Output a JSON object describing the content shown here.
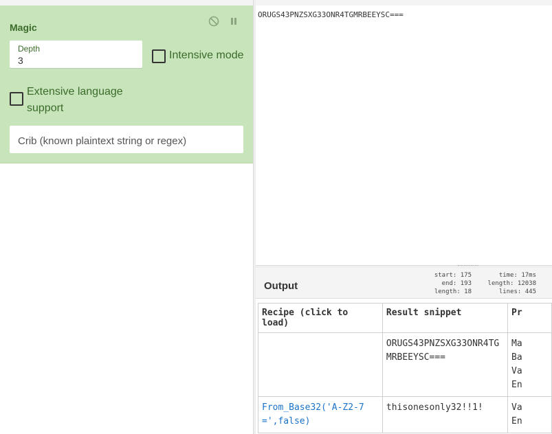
{
  "recipe": {
    "operation": {
      "title": "Magic",
      "depth": {
        "label": "Depth",
        "value": "3"
      },
      "intensive_mode": {
        "label": "Intensive mode",
        "checked": false
      },
      "extensive_language": {
        "label": "Extensive language support",
        "checked": false
      },
      "crib": {
        "placeholder": "Crib (known plaintext string or regex)"
      },
      "controls": {
        "disable_icon": "disable-icon",
        "pause_icon": "pause-icon"
      }
    }
  },
  "input": {
    "text": "ORUGS43PNZSXG33ONR4TGMRBEEYSC==="
  },
  "output": {
    "title": "Output",
    "stats": {
      "start": "start: 175",
      "end": "end: 193",
      "length": "length:  18",
      "time": "time:  17ms",
      "out_length": "length: 12038",
      "lines": "lines:   445"
    },
    "table": {
      "headers": [
        "Recipe (click to load)",
        "Result snippet",
        "Pr"
      ],
      "rows": [
        {
          "recipe": "",
          "snippet": "ORUGS43PNZSXG33ONR4TGMRBEEYSC===",
          "props": [
            "Ma",
            "Ba",
            "Va",
            "En"
          ]
        },
        {
          "recipe": "From_Base32('A-Z2-7=',false)",
          "snippet": "thisonesonly32!!1!",
          "props": [
            "Va",
            "En"
          ]
        }
      ]
    }
  },
  "colors": {
    "operation_bg": "#c7e4ba",
    "operation_text": "#3b6b2a",
    "link": "#1a73c9"
  }
}
